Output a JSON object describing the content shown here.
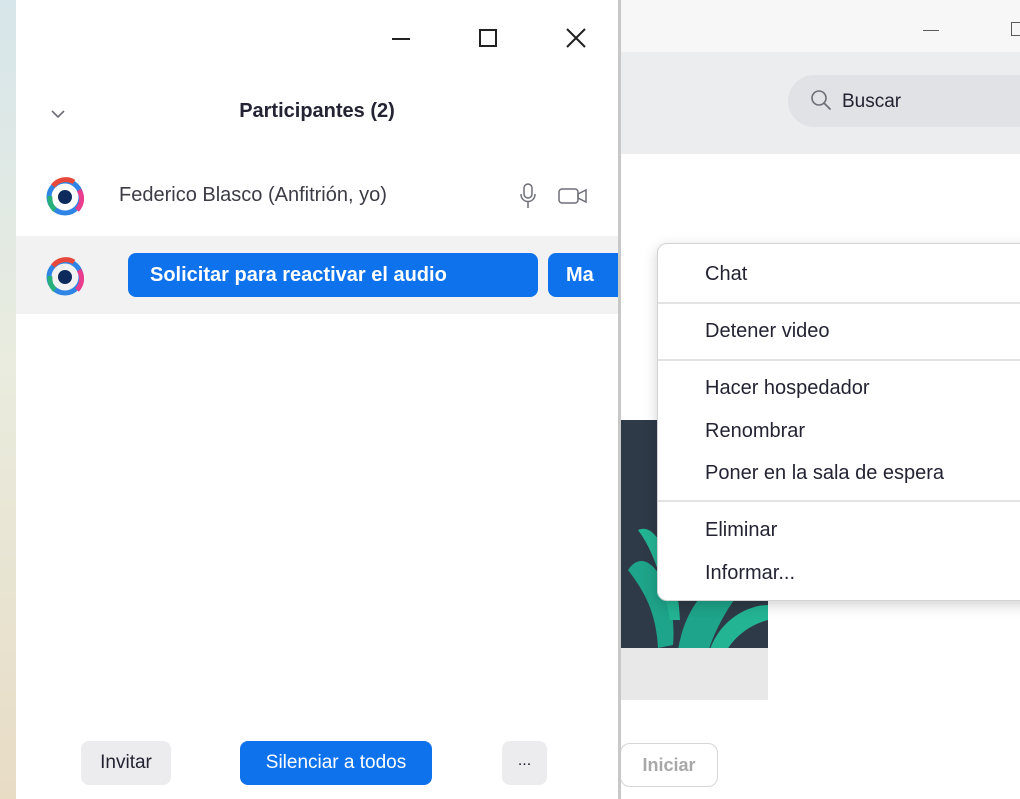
{
  "panel": {
    "title": "Participantes (2)",
    "participants": [
      {
        "name": "Federico Blasco (Anfitrión, yo)"
      },
      {
        "ask_unmute_label": "Solicitar para reactivar el audio",
        "more_label": "Ma"
      }
    ],
    "footer": {
      "invite_label": "Invitar",
      "mute_all_label": "Silenciar a todos",
      "more_label": "..."
    }
  },
  "main_window": {
    "search_placeholder": "Buscar",
    "start_label": "Iniciar"
  },
  "context_menu": {
    "items": [
      "Chat",
      "Detener video",
      "Hacer hospedador",
      "Renombrar",
      "Poner en la sala de espera",
      "Eliminar",
      "Informar..."
    ]
  },
  "colors": {
    "accent": "#0e72ed",
    "text": "#232333"
  }
}
